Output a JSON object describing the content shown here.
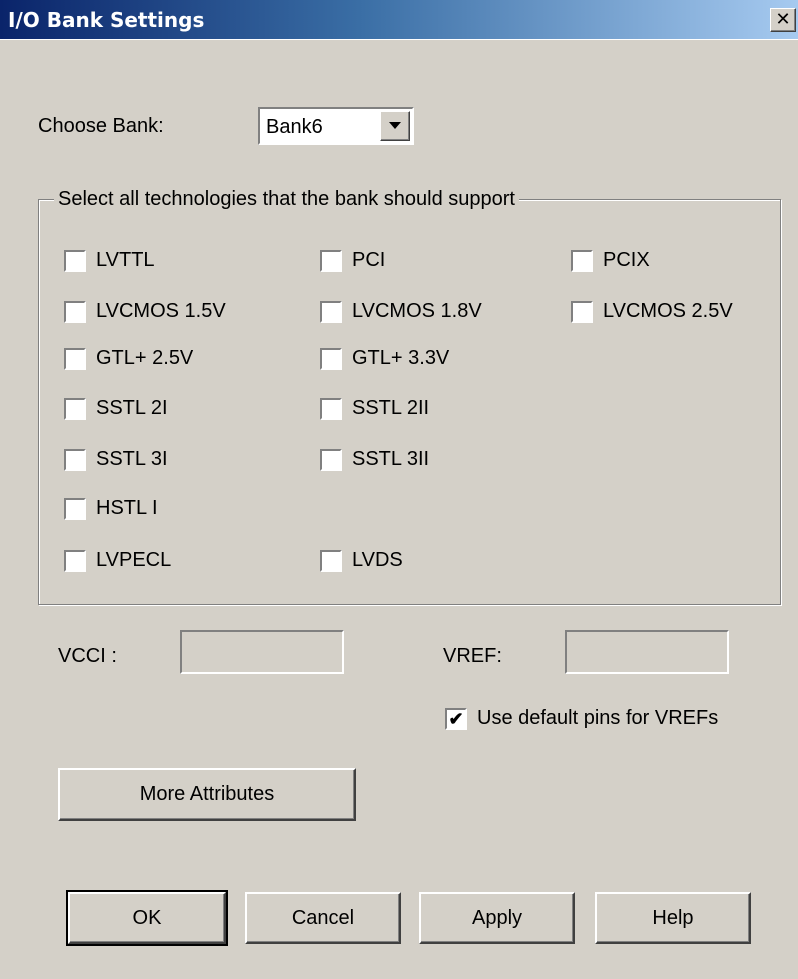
{
  "window": {
    "title": "I/O Bank Settings",
    "close_glyph": "✕"
  },
  "bank": {
    "label": "Choose Bank:",
    "selected": "Bank6"
  },
  "technologies": {
    "legend": "Select all technologies that the bank should support",
    "items": [
      {
        "label": "LVTTL",
        "checked": false
      },
      {
        "label": "PCI",
        "checked": false
      },
      {
        "label": "PCIX",
        "checked": false
      },
      {
        "label": "LVCMOS 1.5V",
        "checked": false
      },
      {
        "label": "LVCMOS 1.8V",
        "checked": false
      },
      {
        "label": "LVCMOS 2.5V",
        "checked": false
      },
      {
        "label": "GTL+ 2.5V",
        "checked": false
      },
      {
        "label": "GTL+ 3.3V",
        "checked": false
      },
      {
        "label": "SSTL 2I",
        "checked": false
      },
      {
        "label": "SSTL 2II",
        "checked": false
      },
      {
        "label": "SSTL 3I",
        "checked": false
      },
      {
        "label": "SSTL 3II",
        "checked": false
      },
      {
        "label": "HSTL I",
        "checked": false
      },
      {
        "label": "LVPECL",
        "checked": false
      },
      {
        "label": "LVDS",
        "checked": false
      }
    ]
  },
  "vcci": {
    "label": "VCCI :",
    "value": ""
  },
  "vref": {
    "label": "VREF:",
    "value": ""
  },
  "default_pins": {
    "label": "Use default pins for VREFs",
    "checked": true,
    "check_glyph": "✔"
  },
  "buttons": {
    "more_attributes": "More Attributes",
    "ok": "OK",
    "cancel": "Cancel",
    "apply": "Apply",
    "help": "Help"
  }
}
